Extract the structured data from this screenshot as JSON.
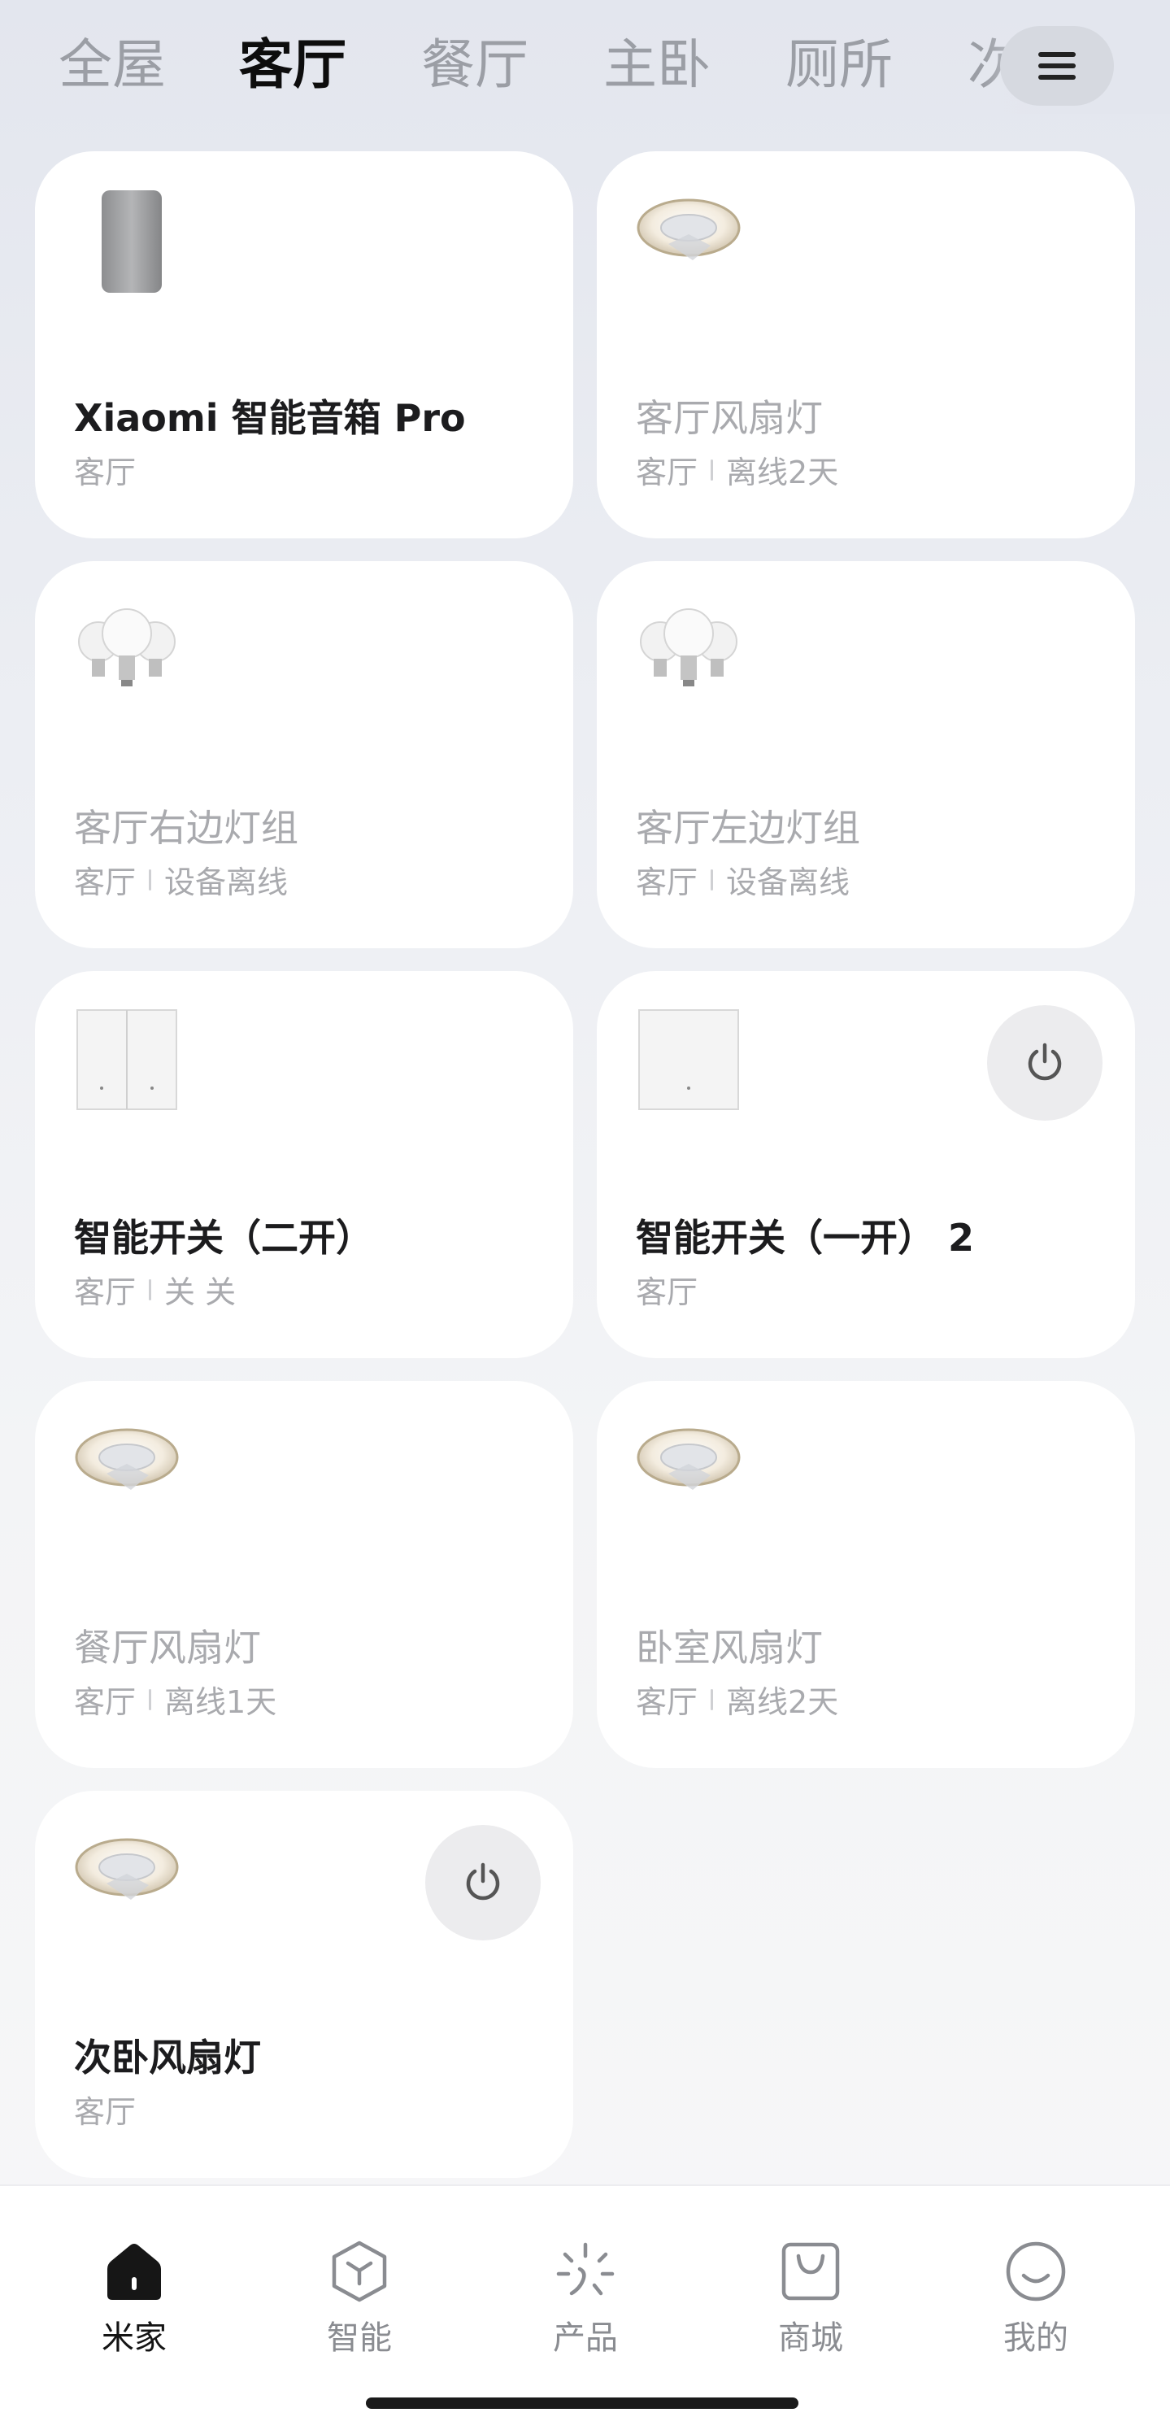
{
  "tabs": [
    "全屋",
    "客厅",
    "餐厅",
    "主卧",
    "厕所",
    "次"
  ],
  "active_tab": 1,
  "devices": [
    {
      "name": "Xiaomi 智能音箱 Pro",
      "room": "客厅",
      "status": "",
      "online": true,
      "icon": "speaker-icon",
      "power": false
    },
    {
      "name": "客厅风扇灯",
      "room": "客厅",
      "status": "离线2天",
      "online": false,
      "icon": "fan-light-icon",
      "power": false
    },
    {
      "name": "客厅右边灯组",
      "room": "客厅",
      "status": "设备离线",
      "online": false,
      "icon": "bulb-group-icon",
      "power": false
    },
    {
      "name": "客厅左边灯组",
      "room": "客厅",
      "status": "设备离线",
      "online": false,
      "icon": "bulb-group-icon",
      "power": false
    },
    {
      "name": "智能开关（二开）",
      "room": "客厅",
      "status": "关 关",
      "online": true,
      "icon": "double-switch-icon",
      "power": false
    },
    {
      "name": "智能开关（一开） 2",
      "room": "客厅",
      "status": "",
      "online": true,
      "icon": "single-switch-icon",
      "power": true
    },
    {
      "name": "餐厅风扇灯",
      "room": "客厅",
      "status": "离线1天",
      "online": false,
      "icon": "fan-light-icon",
      "power": false
    },
    {
      "name": "卧室风扇灯",
      "room": "客厅",
      "status": "离线2天",
      "online": false,
      "icon": "fan-light-icon",
      "power": false
    },
    {
      "name": "次卧风扇灯",
      "room": "客厅",
      "status": "",
      "online": true,
      "icon": "fan-light-icon",
      "power": true
    }
  ],
  "nav": [
    {
      "label": "米家",
      "icon": "home-icon",
      "active": true
    },
    {
      "label": "智能",
      "icon": "smart-cube-icon",
      "active": false
    },
    {
      "label": "产品",
      "icon": "product-sparkle-icon",
      "active": false
    },
    {
      "label": "商城",
      "icon": "shop-bag-icon",
      "active": false
    },
    {
      "label": "我的",
      "icon": "profile-smile-icon",
      "active": false
    }
  ],
  "colors": {
    "accent": "#1c1c1e",
    "muted": "#a9aaae",
    "power_bg": "#ececee"
  }
}
